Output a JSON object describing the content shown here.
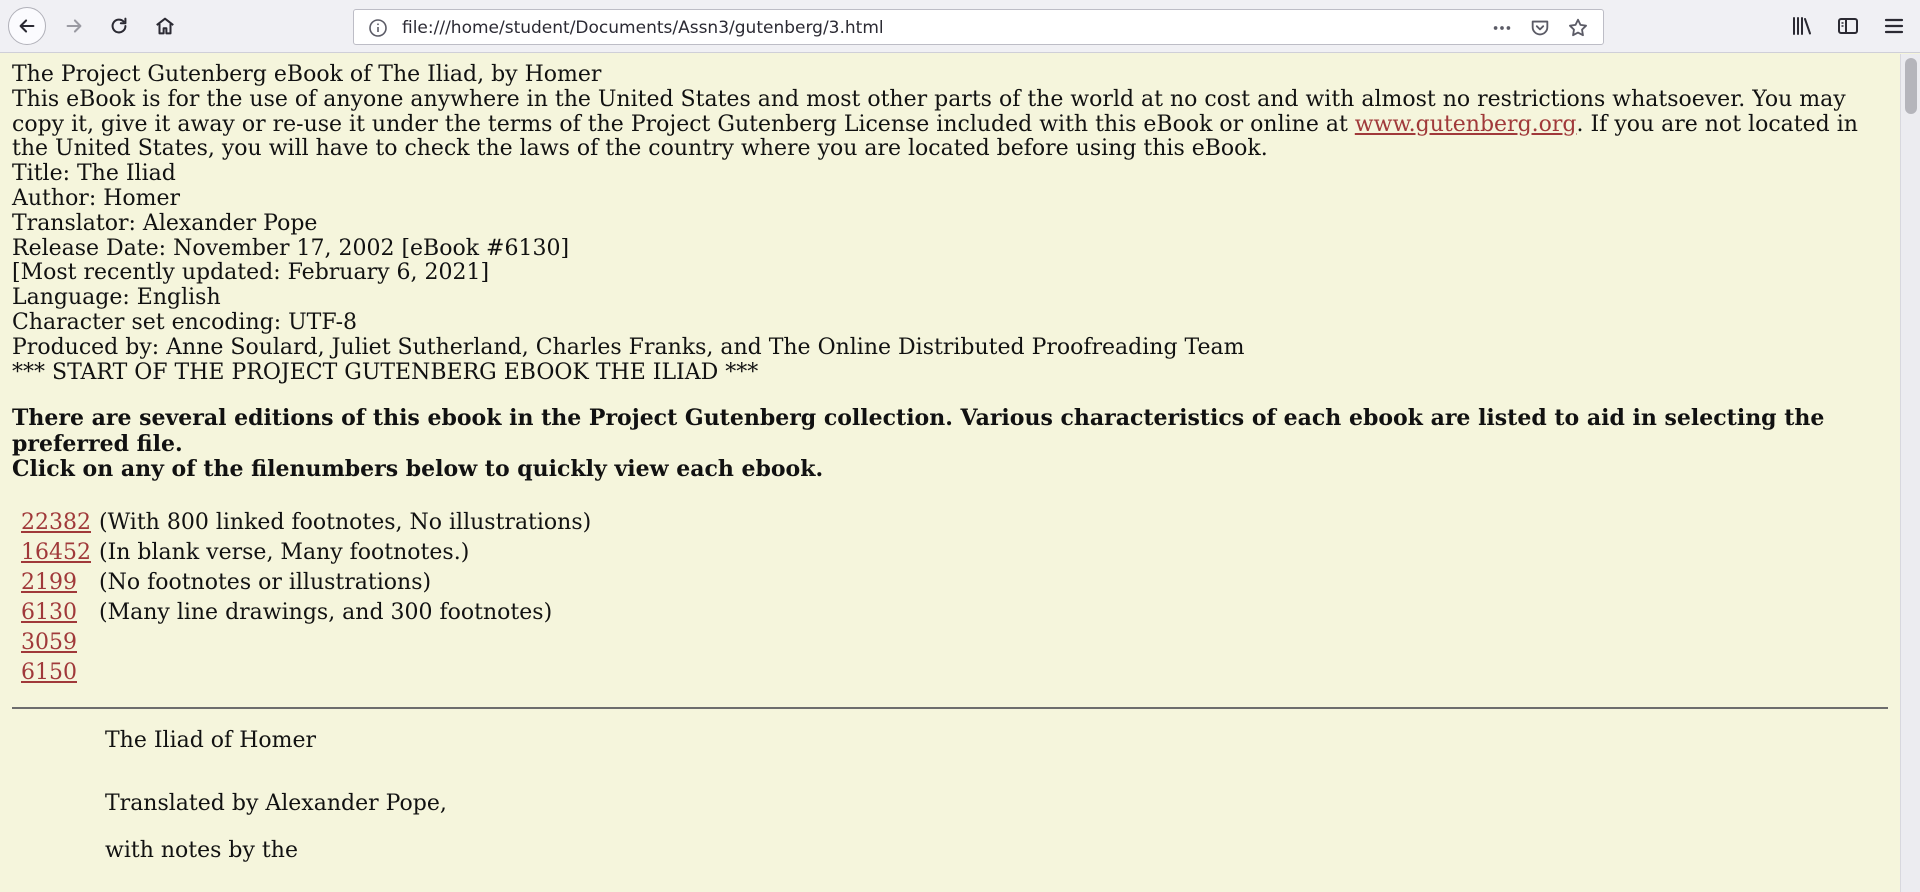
{
  "browser": {
    "url": "file:///home/student/Documents/Assn3/gutenberg/3.html"
  },
  "header_lines": [
    "The Project Gutenberg eBook of The Iliad, by Homer"
  ],
  "license": {
    "text_before": "This eBook is for the use of anyone anywhere in the United States and most other parts of the world at no cost and with almost no restrictions whatsoever. You may copy it, give it away or re-use it under the terms of the Project Gutenberg License included with this eBook or online at ",
    "link": "www.gutenberg.org",
    "text_after": ". If you are not located in the United States, you will have to check the laws of the country where you are located before using this eBook."
  },
  "meta": {
    "title": "Title: The Iliad",
    "author": "Author: Homer",
    "translator": "Translator: Alexander Pope",
    "release": "Release Date: November 17, 2002 [eBook #6130]",
    "updated": "[Most recently updated: February 6, 2021]",
    "language": "Language: English",
    "encoding": "Character set encoding: UTF-8",
    "produced": "Produced by: Anne Soulard, Juliet Sutherland, Charles Franks, and The Online Distributed Proofreading Team",
    "start": "*** START OF THE PROJECT GUTENBERG EBOOK THE ILIAD ***"
  },
  "editions_intro": {
    "line1": "There are several editions of this ebook in the Project Gutenberg collection. Various characteristics of each ebook are listed to aid in selecting the preferred file.",
    "line2": "Click on any of the filenumbers below to quickly view each ebook."
  },
  "editions": [
    {
      "number": "22382",
      "note": "(With 800 linked footnotes, No illustrations)"
    },
    {
      "number": "16452",
      "note": "(In blank verse, Many footnotes.)"
    },
    {
      "number": "2199",
      "note": "(No footnotes or illustrations)"
    },
    {
      "number": "6130",
      "note": "(Many line drawings, and 300 footnotes)"
    },
    {
      "number": "3059",
      "note": ""
    },
    {
      "number": "6150",
      "note": ""
    }
  ],
  "book": {
    "heading": "The Iliad of Homer",
    "translated_by": "Translated by Alexander Pope,",
    "notes_by": "with notes by the"
  }
}
